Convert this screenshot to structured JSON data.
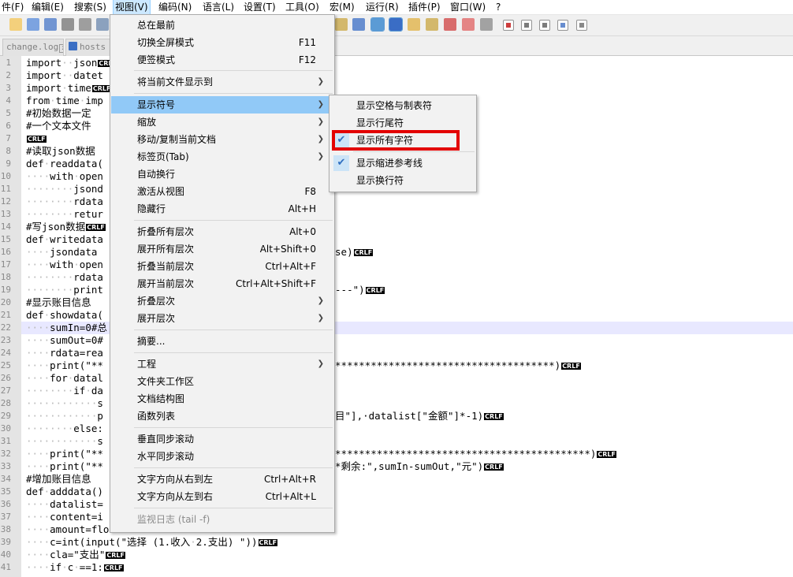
{
  "menubar": {
    "items": [
      "件(F)",
      "编辑(E)",
      "搜索(S)",
      "视图(V)",
      "编码(N)",
      "语言(L)",
      "设置(T)",
      "工具(O)",
      "宏(M)",
      "运行(R)",
      "插件(P)",
      "窗口(W)",
      "?"
    ]
  },
  "tabs": [
    {
      "label": "change.log"
    },
    {
      "label": "hosts"
    }
  ],
  "view_menu": {
    "items": [
      {
        "label": "总在最前",
        "shortcut": "",
        "submenu": false
      },
      {
        "label": "切换全屏模式",
        "shortcut": "F11",
        "submenu": false
      },
      {
        "label": "便签模式",
        "shortcut": "F12",
        "submenu": false
      },
      {
        "label": "将当前文件显示到",
        "shortcut": "",
        "submenu": true
      },
      {
        "label": "显示符号",
        "shortcut": "",
        "submenu": true
      },
      {
        "label": "缩放",
        "shortcut": "",
        "submenu": true
      },
      {
        "label": "移动/复制当前文档",
        "shortcut": "",
        "submenu": true
      },
      {
        "label": "标签页(Tab)",
        "shortcut": "",
        "submenu": true
      },
      {
        "label": "自动换行",
        "shortcut": "",
        "submenu": false
      },
      {
        "label": "激活从视图",
        "shortcut": "F8",
        "submenu": false
      },
      {
        "label": "隐藏行",
        "shortcut": "Alt+H",
        "submenu": false
      },
      {
        "label": "折叠所有层次",
        "shortcut": "Alt+0",
        "submenu": false
      },
      {
        "label": "展开所有层次",
        "shortcut": "Alt+Shift+0",
        "submenu": false
      },
      {
        "label": "折叠当前层次",
        "shortcut": "Ctrl+Alt+F",
        "submenu": false
      },
      {
        "label": "展开当前层次",
        "shortcut": "Ctrl+Alt+Shift+F",
        "submenu": false
      },
      {
        "label": "折叠层次",
        "shortcut": "",
        "submenu": true
      },
      {
        "label": "展开层次",
        "shortcut": "",
        "submenu": true
      },
      {
        "label": "摘要...",
        "shortcut": "",
        "submenu": false
      },
      {
        "label": "工程",
        "shortcut": "",
        "submenu": true
      },
      {
        "label": "文件夹工作区",
        "shortcut": "",
        "submenu": false
      },
      {
        "label": "文档结构图",
        "shortcut": "",
        "submenu": false
      },
      {
        "label": "函数列表",
        "shortcut": "",
        "submenu": false
      },
      {
        "label": "垂直同步滚动",
        "shortcut": "",
        "submenu": false
      },
      {
        "label": "水平同步滚动",
        "shortcut": "",
        "submenu": false
      },
      {
        "label": "文字方向从右到左",
        "shortcut": "Ctrl+Alt+R",
        "submenu": false
      },
      {
        "label": "文字方向从左到右",
        "shortcut": "Ctrl+Alt+L",
        "submenu": false
      },
      {
        "label": "监视日志 (tail -f)",
        "shortcut": "",
        "submenu": false
      }
    ]
  },
  "symbols_submenu": {
    "items": [
      {
        "label": "显示空格与制表符",
        "checked": false
      },
      {
        "label": "显示行尾符",
        "checked": false
      },
      {
        "label": "显示所有字符",
        "checked": true
      },
      {
        "label": "显示缩进参考线",
        "checked": true
      },
      {
        "label": "显示换行符",
        "checked": false
      }
    ]
  },
  "eol_marker": {
    "cr": "CR",
    "lf": "LF"
  },
  "code_lines": [
    {
      "n": "1",
      "text": "import··json",
      "eol": true
    },
    {
      "n": "2",
      "text": "import··datet",
      "eol": false
    },
    {
      "n": "3",
      "text": "import·time",
      "eol": true
    },
    {
      "n": "4",
      "text": "from·time·imp",
      "eol": false
    },
    {
      "n": "5",
      "text": "#初始数据一定",
      "eol": false
    },
    {
      "n": "6",
      "text": "#一个文本文件",
      "eol": false
    },
    {
      "n": "7",
      "text": "",
      "eol": true
    },
    {
      "n": "8",
      "text": "#读取json数据",
      "eol": false
    },
    {
      "n": "9",
      "text": "def·readdata(",
      "eol": false
    },
    {
      "n": "10",
      "text": "····with·open",
      "eol": false
    },
    {
      "n": "11",
      "text": "········jsond",
      "eol": false
    },
    {
      "n": "12",
      "text": "········rdata",
      "eol": false
    },
    {
      "n": "13",
      "text": "········retur",
      "eol": false
    },
    {
      "n": "14",
      "text": "#写json数据",
      "eol": true
    },
    {
      "n": "15",
      "text": "def·writedata",
      "eol": false
    },
    {
      "n": "16",
      "text": "····jsondata",
      "eol": false
    },
    {
      "n": "17",
      "text": "····with·open",
      "eol": false
    },
    {
      "n": "18",
      "text": "········rdata",
      "eol": false
    },
    {
      "n": "19",
      "text": "········print",
      "eol": false
    },
    {
      "n": "20",
      "text": "#显示账目信息",
      "eol": false
    },
    {
      "n": "21",
      "text": "def·showdata(",
      "eol": false
    },
    {
      "n": "22",
      "text": "····sumIn=0#总",
      "eol": false
    },
    {
      "n": "23",
      "text": "····sumOut=0#",
      "eol": false
    },
    {
      "n": "24",
      "text": "····rdata=rea",
      "eol": false
    },
    {
      "n": "25",
      "text": "····print(\"**",
      "eol": false
    },
    {
      "n": "26",
      "text": "····for·datal",
      "eol": false
    },
    {
      "n": "27",
      "text": "········if·da",
      "eol": false
    },
    {
      "n": "28",
      "text": "············s",
      "eol": false
    },
    {
      "n": "29",
      "text": "············p",
      "eol": false
    },
    {
      "n": "30",
      "text": "········else:",
      "eol": false
    },
    {
      "n": "31",
      "text": "············s",
      "eol": false
    },
    {
      "n": "32",
      "text": "····print(\"**",
      "eol": false
    },
    {
      "n": "33",
      "text": "····print(\"**",
      "eol": false
    },
    {
      "n": "34",
      "text": "#增加账目信息",
      "eol": false
    },
    {
      "n": "35",
      "text": "def·adddata()",
      "eol": false
    },
    {
      "n": "36",
      "text": "····datalist=",
      "eol": false
    },
    {
      "n": "37",
      "text": "····content=i",
      "eol": false
    },
    {
      "n": "38",
      "text": "····amount=flo",
      "eol": false
    },
    {
      "n": "39",
      "text": "····c=int(input(\"选择 (1.收入·2.支出) \"))",
      "eol": true
    },
    {
      "n": "40",
      "text": "····cla=\"支出\"",
      "eol": true
    },
    {
      "n": "41",
      "text": "····if·c·==1:",
      "eol": true
    }
  ],
  "right_fragments": [
    {
      "line": "16",
      "text": "se)"
    },
    {
      "line": "19",
      "text": "---\")"
    },
    {
      "line": "25",
      "text": "*************************************)"
    },
    {
      "line": "29",
      "text": "目\"],·datalist[\"金额\"]*-1)"
    },
    {
      "line": "32",
      "text": "*******************************************)"
    },
    {
      "line": "33",
      "text": "*剩余:\",sumIn-sumOut,\"元\")"
    }
  ]
}
